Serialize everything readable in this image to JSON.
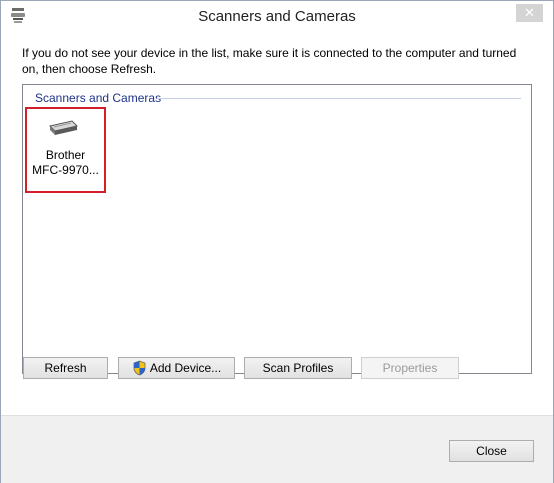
{
  "window": {
    "title": "Scanners and Cameras",
    "close_glyph": "✕"
  },
  "instructions": "If you do not see your device in the list, make sure it is connected to the computer and turned on, then choose Refresh.",
  "list": {
    "group_header": "Scanners and Cameras",
    "devices": [
      {
        "name_line1": "Brother",
        "name_line2": "MFC-9970...",
        "icon": "scanner-icon",
        "selected": true
      }
    ]
  },
  "buttons": {
    "refresh": "Refresh",
    "add_device": "Add Device...",
    "scan_profiles": "Scan Profiles",
    "properties": "Properties",
    "close": "Close"
  },
  "colors": {
    "selection_border": "#d2202a",
    "group_header": "#1e3287"
  }
}
